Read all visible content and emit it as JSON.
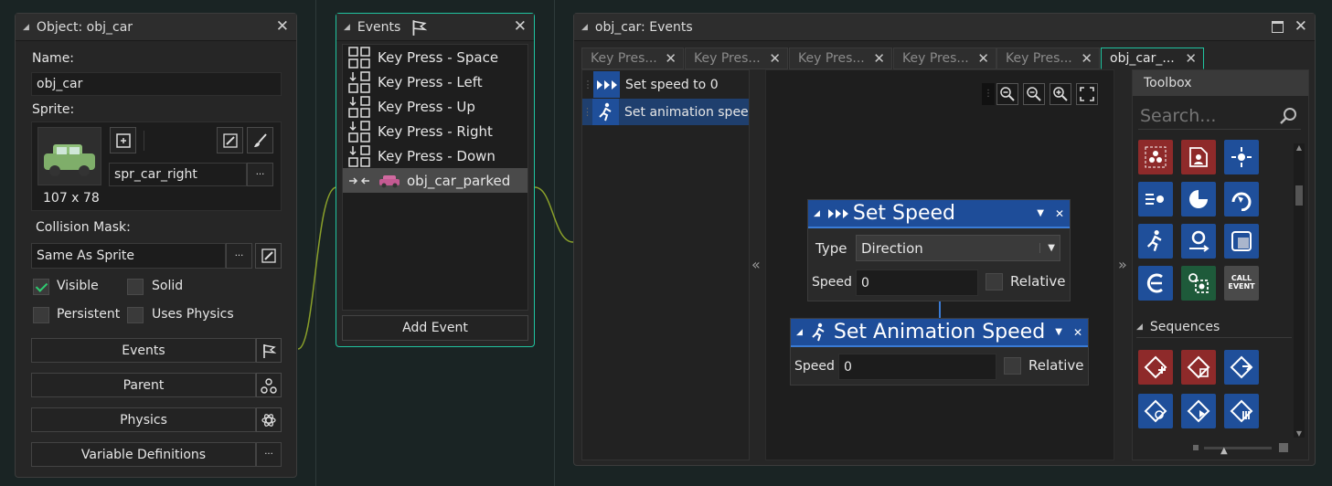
{
  "object_panel": {
    "title": "Object: obj_car",
    "name_label": "Name:",
    "name_value": "obj_car",
    "sprite_label": "Sprite:",
    "sprite_value": "spr_car_right",
    "sprite_size": "107 x 78",
    "collision_label": "Collision Mask:",
    "collision_value": "Same As Sprite",
    "more": "···",
    "checkboxes": {
      "visible": {
        "label": "Visible",
        "checked": true
      },
      "solid": {
        "label": "Solid",
        "checked": false
      },
      "persistent": {
        "label": "Persistent",
        "checked": false
      },
      "uses_physics": {
        "label": "Uses Physics",
        "checked": false
      }
    },
    "buttons": {
      "events": "Events",
      "parent": "Parent",
      "physics": "Physics",
      "variable_definitions": "Variable Definitions"
    }
  },
  "events_panel": {
    "title": "Events",
    "items": [
      "Key Press - Space",
      "Key Press - Left",
      "Key Press - Up",
      "Key Press - Right",
      "Key Press - Down",
      "obj_car_parked"
    ],
    "add_event": "Add Event"
  },
  "editor_panel": {
    "title": "obj_car: Events",
    "tabs": [
      "Key Pres...",
      "Key Pres...",
      "Key Pres...",
      "Key Pres...",
      "Key Pres...",
      "obj_car_..."
    ],
    "actions": [
      "Set speed to 0",
      "Set animation speed"
    ],
    "collapse_left": "«",
    "collapse_right": "»",
    "node_set_speed": {
      "title": "Set Speed",
      "type_label": "Type",
      "type_value": "Direction",
      "speed_label": "Speed",
      "speed_value": "0",
      "relative_label": "Relative"
    },
    "node_set_anim": {
      "title": "Set Animation Speed",
      "speed_label": "Speed",
      "speed_value": "0",
      "relative_label": "Relative"
    },
    "toolbox": {
      "title": "Toolbox",
      "search_placeholder": "Search...",
      "call_event": "CALL EVENT",
      "sequences_label": "Sequences"
    }
  },
  "colors": {
    "accent": "#20c4a0",
    "node_header": "#1e4d99",
    "tool_red": "#8e2a2a",
    "tool_blue": "#1f4f9a",
    "check": "#2ecc71"
  }
}
